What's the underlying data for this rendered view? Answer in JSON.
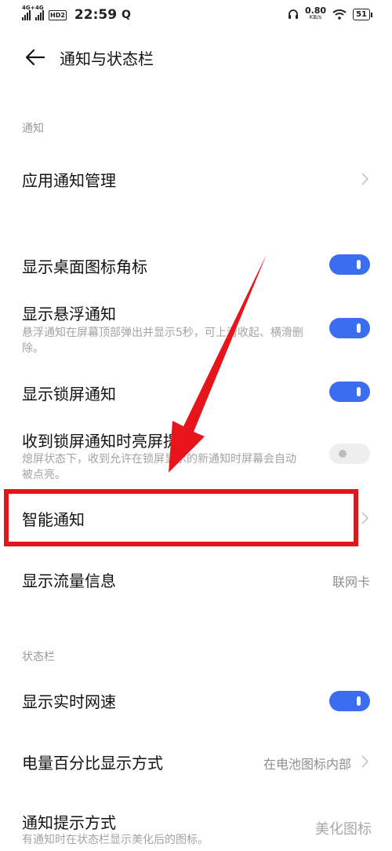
{
  "status_bar": {
    "net1": "4G+",
    "net2": "4G",
    "hd": "HD2",
    "time": "22:59",
    "extra_icon": "Q",
    "speed_value": "0.80",
    "speed_unit": "KB/s",
    "battery": "51"
  },
  "header": {
    "title": "通知与状态栏"
  },
  "sections": {
    "notify_label": "通知",
    "statusbar_label": "状态栏"
  },
  "rows": {
    "app_notify": {
      "title": "应用通知管理"
    },
    "desktop_badge": {
      "title": "显示桌面图标角标",
      "toggle": "on"
    },
    "floating": {
      "title": "显示悬浮通知",
      "subtitle": "悬浮通知在屏幕顶部弹出并显示5秒，可上滑收起、横滑删除。",
      "toggle": "on"
    },
    "lockscreen": {
      "title": "显示锁屏通知",
      "toggle": "on"
    },
    "wake_screen": {
      "title": "收到锁屏通知时亮屏提醒",
      "subtitle": "熄屏状态下，收到允许在锁屏显示的新通知时屏幕会自动被点亮。",
      "toggle": "off"
    },
    "smart": {
      "title": "智能通知"
    },
    "data_usage": {
      "title": "显示流量信息",
      "value": "联网卡"
    },
    "realtime_speed": {
      "title": "显示实时网速",
      "toggle": "on"
    },
    "battery_percent": {
      "title": "电量百分比显示方式",
      "value": "在电池图标内部"
    },
    "notify_style": {
      "title": "通知提示方式",
      "subtitle": "有通知时在状态栏显示美化后的图标。"
    }
  },
  "watermark": "美化图标",
  "colors": {
    "accent": "#3a6df0",
    "annotation_red": "#e8141b"
  },
  "icons": [
    "back-arrow-icon",
    "chevron-right-icon",
    "wifi-icon",
    "headphone-icon",
    "battery-icon",
    "signal-icon"
  ]
}
